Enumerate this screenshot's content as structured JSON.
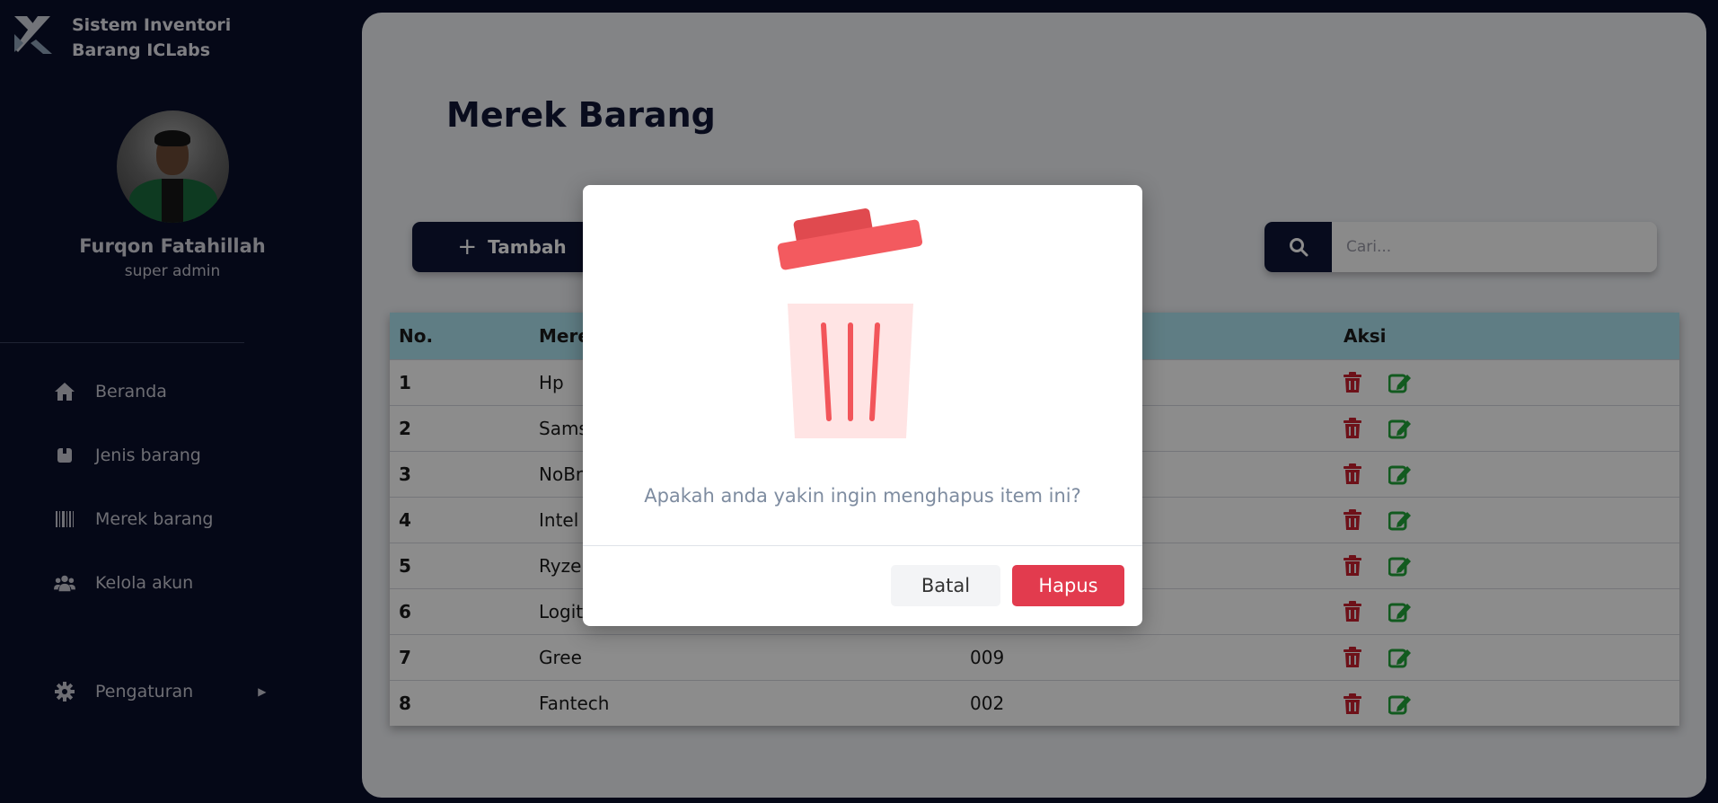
{
  "app": {
    "title_line1": "Sistem Inventori",
    "title_line2": "Barang ICLabs"
  },
  "user": {
    "name": "Furqon Fatahillah",
    "role": "super admin"
  },
  "sidebar": {
    "items": [
      {
        "label": "Beranda",
        "icon": "home-icon"
      },
      {
        "label": "Jenis barang",
        "icon": "box-icon"
      },
      {
        "label": "Merek barang",
        "icon": "barcode-icon"
      },
      {
        "label": "Kelola akun",
        "icon": "users-icon"
      },
      {
        "label": "Pengaturan",
        "icon": "gear-icon"
      }
    ]
  },
  "main": {
    "title": "Merek Barang",
    "add_label": "Tambah",
    "search": {
      "placeholder": "Cari..."
    },
    "table": {
      "columns": [
        "No.",
        "Merek",
        "",
        "Aksi"
      ],
      "rows": [
        {
          "no": "1",
          "merek": "Hp",
          "kode": ""
        },
        {
          "no": "2",
          "merek": "Samsung",
          "kode": ""
        },
        {
          "no": "3",
          "merek": "NoBrand",
          "kode": ""
        },
        {
          "no": "4",
          "merek": "Intel",
          "kode": ""
        },
        {
          "no": "5",
          "merek": "Ryzen",
          "kode": ""
        },
        {
          "no": "6",
          "merek": "Logitech",
          "kode": ""
        },
        {
          "no": "7",
          "merek": "Gree",
          "kode": "009"
        },
        {
          "no": "8",
          "merek": "Fantech",
          "kode": "002"
        }
      ]
    }
  },
  "modal": {
    "message": "Apakah anda yakin ingin menghapus item ini?",
    "cancel_label": "Batal",
    "delete_label": "Hapus"
  },
  "colors": {
    "sidebar_bg": "#0a0f2a",
    "primary": "#0e1436",
    "danger": "#e23b4e",
    "edit": "#22a43a",
    "table_header": "#aee3f0"
  }
}
